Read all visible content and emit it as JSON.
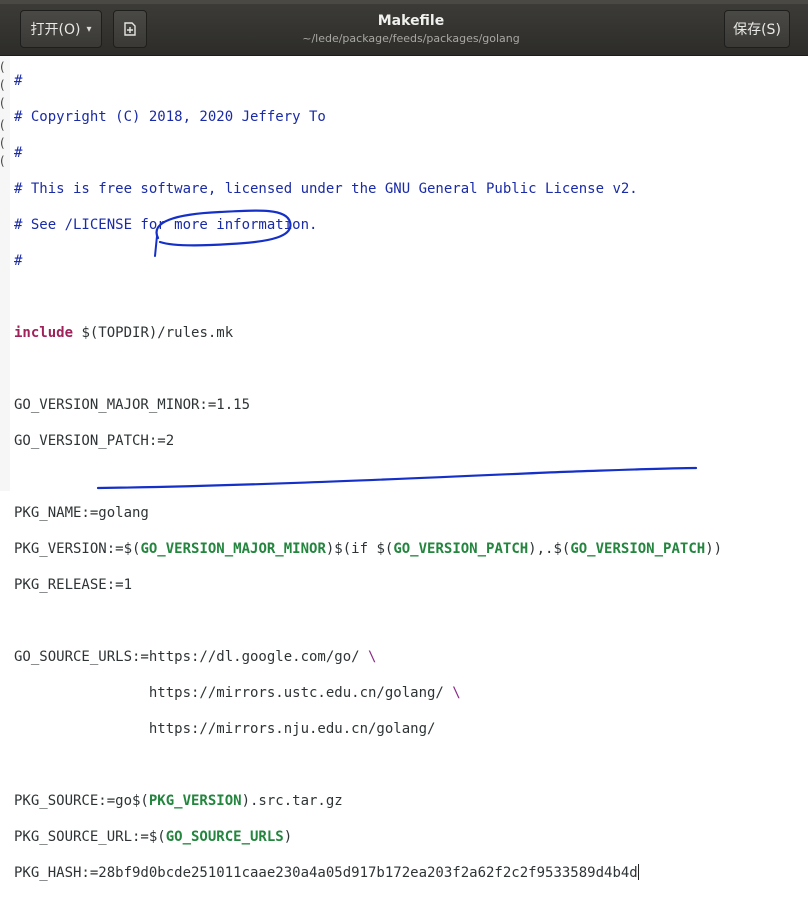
{
  "header": {
    "open_label": "打开(O)",
    "open_caret": "▾",
    "new_icon": "new-document-icon",
    "save_label": "保存(S)",
    "title": "Makefile",
    "path": "~/lede/package/feeds/packages/golang"
  },
  "gutter": {
    "marks": [
      "(",
      "(",
      "(",
      "(",
      "(",
      "("
    ]
  },
  "editor": {
    "lines": {
      "l1": "#",
      "l2": "# Copyright (C) 2018, 2020 Jeffery To",
      "l3": "#",
      "l4": "# This is free software, licensed under the GNU General Public License v2.",
      "l5": "# See /LICENSE for more information.",
      "l6": "#",
      "l8_kw": "include",
      "l8_rest": " $(TOPDIR)/rules.mk",
      "l10": "GO_VERSION_MAJOR_MINOR:=1.15",
      "l11": "GO_VERSION_PATCH:=2",
      "l13": "PKG_NAME:=golang",
      "l14_a": "PKG_VERSION:=$(",
      "l14_v1": "GO_VERSION_MAJOR_MINOR",
      "l14_b": ")$(if $(",
      "l14_v2": "GO_VERSION_PATCH",
      "l14_c": "),.$(",
      "l14_v3": "GO_VERSION_PATCH",
      "l14_d": "))",
      "l15": "PKG_RELEASE:=1",
      "l17_a": "GO_SOURCE_URLS:=https://dl.google.com/go/ ",
      "l17_bs": "\\",
      "l18_a": "                https://mirrors.ustc.edu.cn/golang/ ",
      "l18_bs": "\\",
      "l19": "                https://mirrors.nju.edu.cn/golang/",
      "l21_a": "PKG_SOURCE:=go$(",
      "l21_v": "PKG_VERSION",
      "l21_b": ").src.tar.gz",
      "l22_a": "PKG_SOURCE_URL:=$(",
      "l22_v": "GO_SOURCE_URLS",
      "l22_b": ")",
      "l23": "PKG_HASH:=28bf9d0bcde251011caae230a4a05d917b172ea203f2a62f2c2f9533589d4b4d"
    }
  },
  "annotations": {
    "ink_color": "#1530c8"
  }
}
